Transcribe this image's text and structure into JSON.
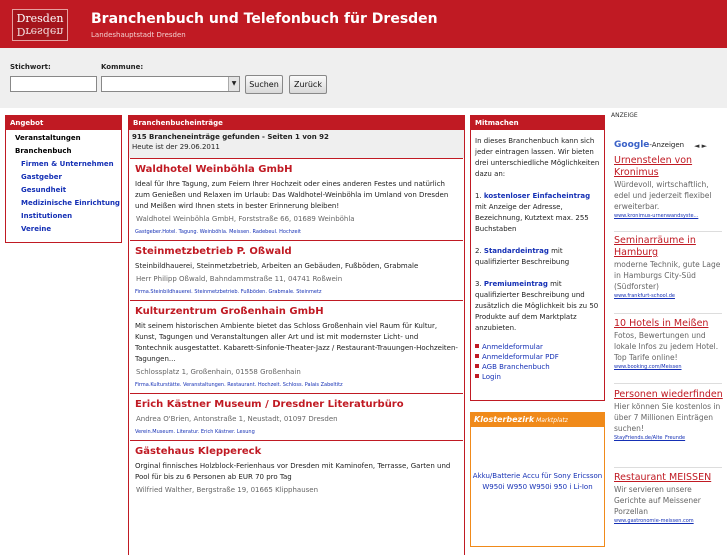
{
  "header": {
    "logo_line1": "Dresden",
    "logo_line2": "Dresden",
    "title": "Branchenbuch und Telefonbuch für Dresden",
    "subtitle": "Landeshauptstadt Dresden"
  },
  "search": {
    "stichwort_label": "Stichwort:",
    "kommune_label": "Kommune:",
    "stichwort_value": "",
    "kommune_value": "",
    "search_button": "Suchen",
    "back_button": "Zurück"
  },
  "nav": {
    "heading": "Angebot",
    "items": [
      {
        "label": "Veranstaltungen",
        "level": "top"
      },
      {
        "label": "Branchenbuch",
        "level": "top"
      },
      {
        "label": "Firmen & Unternehmen",
        "level": "sub"
      },
      {
        "label": "Gastgeber",
        "level": "sub"
      },
      {
        "label": "Gesundheit",
        "level": "sub"
      },
      {
        "label": "Medizinische Einrichtung",
        "level": "sub"
      },
      {
        "label": "Institutionen",
        "level": "sub"
      },
      {
        "label": "Vereine",
        "level": "sub"
      }
    ]
  },
  "main": {
    "heading": "Branchenbucheinträge",
    "count_text": "915 Brancheneinträge gefunden",
    "pages_text": "- Seiten 1 von 92",
    "date_text": "Heute ist der 29.06.2011",
    "entries": [
      {
        "title": "Waldhotel Weinböhla GmbH",
        "desc": "Ideal für Ihre Tagung, zum Feiern Ihrer Hochzeit oder eines anderen Festes und natürlich zum Genießen und Relaxen im Urlaub: Das Waldhotel-Weinböhla im Umland von Dresden und Meißen wird Ihnen stets in bester Erinnerung bleiben!",
        "addr": "Waldhotel Weinböhla GmbH, Forststraße 66, 01689 Weinböhla",
        "tags": "Gastgeber.Hotel. Tagung. Weinböhla. Meissen. Radebeul. Hochzeit"
      },
      {
        "title": "Steinmetzbetrieb P. Oßwald",
        "desc": "Steinbildhauerei, Steinmetzbetrieb, Arbeiten an Gebäuden, Fußböden, Grabmale",
        "addr": "Herr Philipp Oßwald, Bahndammstraße 11, 04741 Roßwein",
        "tags": "Firma.Steinbildhauerei. Steinmetzbetrieb. Fußböden. Grabmale. Steinmetz"
      },
      {
        "title": "Kulturzentrum Großenhain GmbH",
        "desc": "Mit seinem historischen Ambiente bietet das Schloss Großenhain viel Raum für Kultur, Kunst, Tagungen und Veranstaltungen aller Art und ist mit modernster Licht- und Tontechnik ausgestattet. Kabarett-Sinfonie-Theater-Jazz / Restaurant-Trauungen-Hochzeiten-Tagungen...",
        "addr": "Schlossplatz 1, Großenhain, 01558 Großenhain",
        "tags": "Firma.Kulturstätte. Veranstaltungen. Restaurant. Hochzeit. Schloss. Palais Zabeltitz"
      },
      {
        "title": "Erich Kästner Museum / Dresdner Literaturbüro",
        "desc": "",
        "addr": "Andrea O'Brien, Antonstraße 1, Neustadt, 01097 Dresden",
        "tags": "Verein.Museum. Literatur. Erich Kästner. Lesung"
      },
      {
        "title": "Gästehaus Kleppereck",
        "desc": "Orginal finnisches Holzblock-Ferienhaus vor Dresden mit Kaminofen, Terrasse, Garten und Pool für bis zu 6 Personen ab EUR 70 pro Tag",
        "addr": "Wilfried Walther, Bergstraße 19, 01665 Klipphausen",
        "tags": ""
      }
    ]
  },
  "mitmachen": {
    "heading": "Mitmachen",
    "intro": "In dieses Branchenbuch kann sich jeder eintragen lassen. Wir bieten drei unterschiedliche Möglichkeiten dazu an:",
    "opt1_prefix": "1. ",
    "opt1_link": "kostenloser Einfacheintrag",
    "opt1_text": " mit Anzeige der Adresse, Bezeichnung, Kutztext max. 255 Buchstaben",
    "opt2_prefix": "2. ",
    "opt2_link": "Standardeintrag",
    "opt2_text": " mit qualifizierter Beschreibung",
    "opt3_prefix": "3. ",
    "opt3_link": "Premiumeintrag",
    "opt3_text": " mit qualifizierter Beschreibung und zusätzlich die Möglichkeit bis zu 50 Produkte auf dem Marktplatz anzubieten.",
    "links": [
      "Anmeldeformular",
      "Anmeldeformular PDF",
      "AGB Branchenbuch",
      "Login"
    ]
  },
  "kloster": {
    "brand": "Klosterbezirk",
    "brand_sub": " Marktplatz",
    "product": "Akku/Batterie Accu für Sony Ericsson W950i W950 W950i 950 i Li-Ion"
  },
  "ads": {
    "anzeige": "ANZEIGE",
    "google_label": "Google",
    "anzeigen_label": "-Anzeigen",
    "nav_arrows": "◄ ►",
    "items": [
      {
        "title": "Urnenstelen von Kronimus",
        "desc": "Würdevoll, wirtschaftlich, edel und jederzeit flexibel erweiterbar.",
        "url": "www.kronimus-urnenwandsyste..."
      },
      {
        "title": "Seminarräume in Hamburg",
        "desc": "moderne Technik, gute Lage in Hamburgs City-Süd (Südforster)",
        "url": "www.frankfurt-school.de"
      },
      {
        "title": "10 Hotels in Meißen",
        "desc": "Fotos, Bewertungen und lokale Infos zu jedem Hotel. Top Tarife online!",
        "url": "www.booking.com/Meissen"
      },
      {
        "title": "Personen wiederfinden",
        "desc": "Hier können Sie kostenlos in über 7 Millionen Einträgen suchen!",
        "url": "StayFriends.de/Alte_Freunde"
      },
      {
        "title": "Restaurant MEISSEN",
        "desc": "Wir servieren unsere Gerichte auf Meissener Porzellan",
        "url": "www.gastronomie-meissen.com"
      }
    ]
  },
  "colors": {
    "brand_red": "#c01a23",
    "link_blue": "#1530b5",
    "accent_orange": "#f08a1a"
  }
}
